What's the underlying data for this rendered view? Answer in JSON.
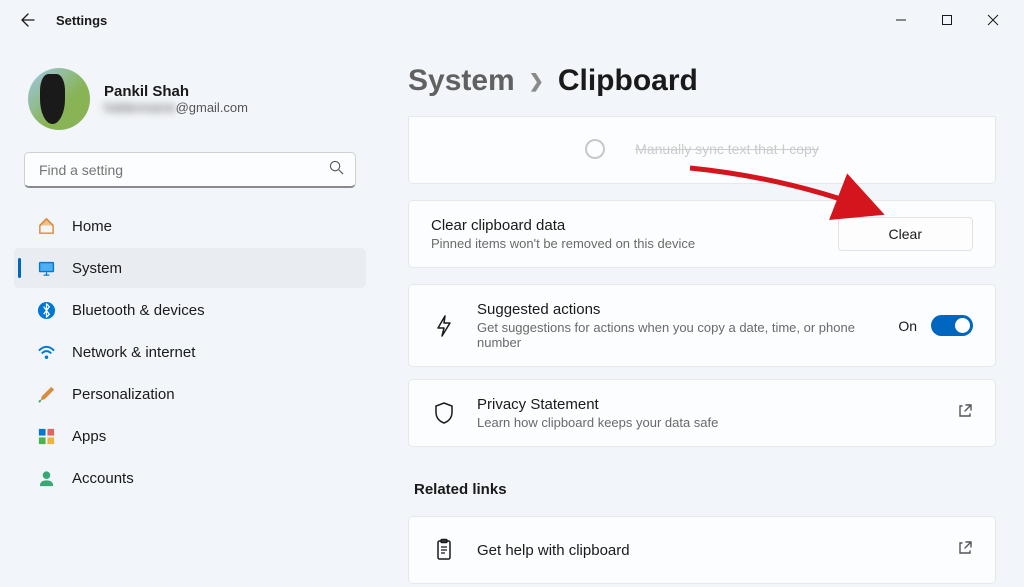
{
  "titlebar": {
    "label": "Settings"
  },
  "user": {
    "name": "Pankil Shah",
    "emailSuffix": "@gmail.com"
  },
  "search": {
    "placeholder": "Find a setting"
  },
  "nav": [
    {
      "id": "home",
      "label": "Home"
    },
    {
      "id": "system",
      "label": "System"
    },
    {
      "id": "bluetooth",
      "label": "Bluetooth & devices"
    },
    {
      "id": "network",
      "label": "Network & internet"
    },
    {
      "id": "personalization",
      "label": "Personalization"
    },
    {
      "id": "apps",
      "label": "Apps"
    },
    {
      "id": "accounts",
      "label": "Accounts"
    }
  ],
  "breadcrumb": {
    "parent": "System",
    "current": "Clipboard"
  },
  "partialCard": {
    "radioLabel": "Manually sync text that I copy"
  },
  "clearCard": {
    "title": "Clear clipboard data",
    "sub": "Pinned items won't be removed on this device",
    "button": "Clear"
  },
  "suggestedCard": {
    "title": "Suggested actions",
    "sub": "Get suggestions for actions when you copy a date, time, or phone number",
    "toggleLabel": "On"
  },
  "privacyCard": {
    "title": "Privacy Statement",
    "sub": "Learn how clipboard keeps your data safe"
  },
  "related": {
    "header": "Related links",
    "helpTitle": "Get help with clipboard"
  },
  "colors": {
    "accent": "#0067c0"
  }
}
